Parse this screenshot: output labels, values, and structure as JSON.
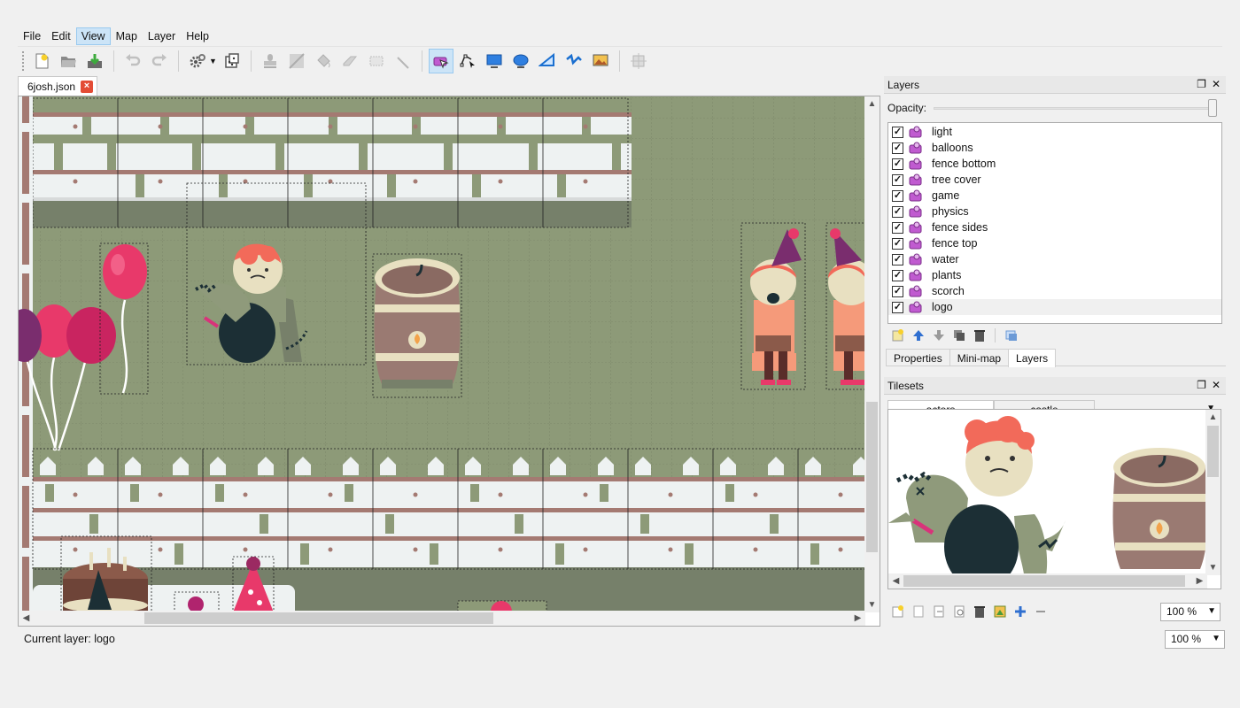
{
  "menubar": {
    "items": [
      {
        "label": "File"
      },
      {
        "label": "Edit"
      },
      {
        "label": "View"
      },
      {
        "label": "Map"
      },
      {
        "label": "Layer"
      },
      {
        "label": "Help"
      }
    ]
  },
  "document": {
    "tab_title": "6josh.json"
  },
  "layers_panel": {
    "title": "Layers",
    "opacity_label": "Opacity:",
    "opacity_value": 1.0,
    "layers": [
      {
        "name": "light",
        "visible": true
      },
      {
        "name": "balloons",
        "visible": true
      },
      {
        "name": "fence bottom",
        "visible": true
      },
      {
        "name": "tree cover",
        "visible": true
      },
      {
        "name": "game",
        "visible": true
      },
      {
        "name": "physics",
        "visible": true
      },
      {
        "name": "fence sides",
        "visible": true
      },
      {
        "name": "fence top",
        "visible": true
      },
      {
        "name": "water",
        "visible": true
      },
      {
        "name": "plants",
        "visible": true
      },
      {
        "name": "scorch",
        "visible": true
      },
      {
        "name": "logo",
        "visible": true,
        "selected": true
      }
    ],
    "bottom_tabs": [
      {
        "label": "Properties"
      },
      {
        "label": "Mini-map"
      },
      {
        "label": "Layers",
        "active": true
      }
    ]
  },
  "tilesets_panel": {
    "title": "Tilesets",
    "tabs": [
      {
        "label": "actors",
        "active": true
      },
      {
        "label": "castle"
      }
    ],
    "zoom": "100 %"
  },
  "status": {
    "current_layer": "Current layer: logo",
    "zoom": "100 %"
  },
  "colors": {
    "map_ground": "#8d9a78",
    "fence_white": "#eef2f2",
    "fence_brown": "#a47a72",
    "layer_icon_purple": "#c05bd0",
    "selection_blue": "#cce4f7"
  }
}
